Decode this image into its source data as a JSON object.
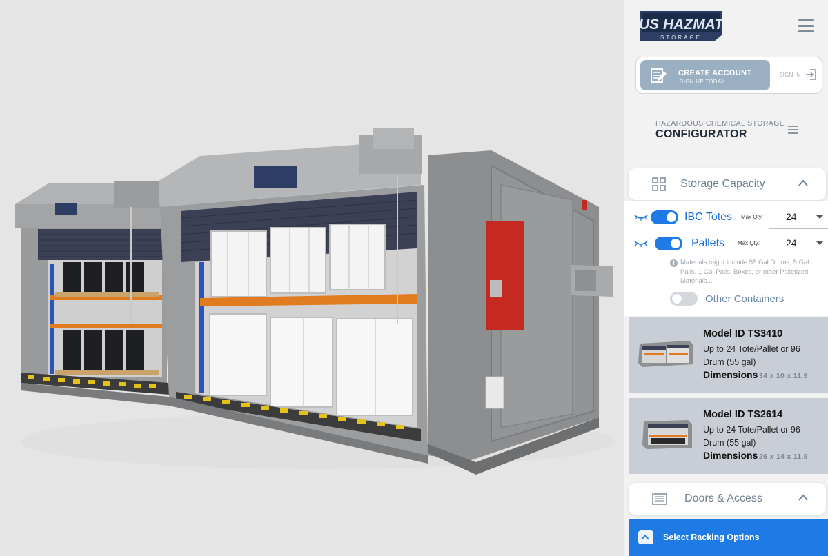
{
  "brand": {
    "logo_line1": "US HAZMAT",
    "logo_line2": "STORAGE"
  },
  "account": {
    "create_label": "CREATE ACCOUNT",
    "create_sub": "SIGN UP TODAY",
    "signin_label": "SIGN IN"
  },
  "configurator": {
    "subtitle": "HAZARDOUS CHEMICAL STORAGE",
    "title": "CONFIGURATOR"
  },
  "storage_capacity": {
    "title": "Storage Capacity",
    "expanded": true,
    "rows": [
      {
        "label": "IBC Totes",
        "enabled": true,
        "max_qty_label": "Max Qty:",
        "max_qty": "24"
      },
      {
        "label": "Pallets",
        "enabled": true,
        "max_qty_label": "Max Qty:",
        "max_qty": "24"
      }
    ],
    "note": "Materials might include 55 Gal Drums, 5 Gal Pails, 1 Gal Pails, Boxes, or other Palletized Materials...",
    "other": {
      "label": "Other Containers",
      "enabled": false
    }
  },
  "models": [
    {
      "id": "Model ID TS3410",
      "desc": "Up to 24 Tote/Pallet or 96 Drum (55 gal)",
      "dims_label": "Dimensions",
      "dims": "34 x 10 x 11.9"
    },
    {
      "id": "Model ID TS2614",
      "desc": "Up to 24 Tote/Pallet or 96 Drum (55 gal)",
      "dims_label": "Dimensions",
      "dims": "26 x 14 x 11.9"
    }
  ],
  "doors_access": {
    "title": "Doors & Access",
    "expanded": true
  },
  "racking": {
    "label": "Select Racking Options"
  },
  "colors": {
    "accent": "#1e7be6",
    "button_muted": "#9aafc2",
    "card_bg": "#c9ced6",
    "building": "#8f8f8f",
    "extinguisher": "#c42a20"
  },
  "icons": [
    "logo",
    "hamburger-icon",
    "edit-document-icon",
    "sign-in-icon",
    "grid-icon",
    "chevron-up-icon",
    "eye-icon",
    "info-icon",
    "door-icon"
  ]
}
